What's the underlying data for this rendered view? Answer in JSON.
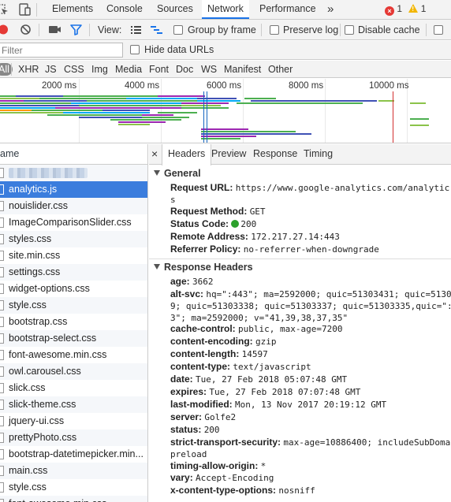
{
  "top_tabs": [
    "Elements",
    "Console",
    "Sources",
    "Network",
    "Performance"
  ],
  "top_more": "»",
  "error_count": "1",
  "warning_count": "1",
  "toolbar": {
    "view_label": "View:",
    "group_by_frame": "Group by frame",
    "preserve_log": "Preserve log",
    "disable_cache": "Disable cache"
  },
  "filter": {
    "placeholder": "Filter",
    "hide_data_urls": "Hide data URLs"
  },
  "type_filters": [
    "All",
    "XHR",
    "JS",
    "CSS",
    "Img",
    "Media",
    "Font",
    "Doc",
    "WS",
    "Manifest",
    "Other"
  ],
  "overview_ticks": [
    "2000 ms",
    "4000 ms",
    "6000 ms",
    "8000 ms",
    "10000 ms"
  ],
  "name_column_header": "ame",
  "files": [
    "",
    "analytics.js",
    "nouislider.css",
    "ImageComparisonSlider.css",
    "styles.css",
    "site.min.css",
    "settings.css",
    "widget-options.css",
    "style.css",
    "bootstrap.css",
    "bootstrap-select.css",
    "font-awesome.min.css",
    "owl.carousel.css",
    "slick.css",
    "slick-theme.css",
    "jquery-ui.css",
    "prettyPhoto.css",
    "bootstrap-datetimepicker.min...",
    "main.css",
    "style.css",
    "font-awesome.min.css"
  ],
  "detail_tabs": [
    "Headers",
    "Preview",
    "Response",
    "Timing"
  ],
  "general": {
    "title": "General",
    "request_url_key": "Request URL:",
    "request_url_value": "https://www.google-analytics.com/analytic",
    "request_url_wrap": "s",
    "request_method_key": "Request Method:",
    "request_method_value": "GET",
    "status_code_key": "Status Code:",
    "status_code_value": "200",
    "remote_address_key": "Remote Address:",
    "remote_address_value": "172.217.27.14:443",
    "referrer_policy_key": "Referrer Policy:",
    "referrer_policy_value": "no-referrer-when-downgrade"
  },
  "response_headers": {
    "title": "Response Headers",
    "age_key": "age:",
    "age_value": "3662",
    "alt_svc_key": "alt-svc:",
    "alt_svc_line1": "hq=\":443\"; ma=2592000; quic=51303431; quic=5130",
    "alt_svc_line2": "9; quic=51303338; quic=51303337; quic=51303335,quic=\":",
    "alt_svc_line3": "3\"; ma=2592000; v=\"41,39,38,37,35\"",
    "cache_control_key": "cache-control:",
    "cache_control_value": "public, max-age=7200",
    "content_encoding_key": "content-encoding:",
    "content_encoding_value": "gzip",
    "content_length_key": "content-length:",
    "content_length_value": "14597",
    "content_type_key": "content-type:",
    "content_type_value": "text/javascript",
    "date_key": "date:",
    "date_value": "Tue, 27 Feb 2018 05:07:48 GMT",
    "expires_key": "expires:",
    "expires_value": "Tue, 27 Feb 2018 07:07:48 GMT",
    "last_modified_key": "last-modified:",
    "last_modified_value": "Mon, 13 Nov 2017 20:19:12 GMT",
    "server_key": "server:",
    "server_value": "Golfe2",
    "status_key": "status:",
    "status_value": "200",
    "sts_key": "strict-transport-security:",
    "sts_value": "max-age=10886400; includeSubDoma",
    "sts_wrap": "preload",
    "tao_key": "timing-allow-origin:",
    "tao_value": "*",
    "vary_key": "vary:",
    "vary_value": "Accept-Encoding",
    "xcto_key": "x-content-type-options:",
    "xcto_value": "nosniff"
  },
  "colors": {
    "accent_blue": "#1a73e8",
    "selected_row": "#3b7ddd",
    "record_red": "#e53935",
    "status_green": "#2ca12c"
  }
}
